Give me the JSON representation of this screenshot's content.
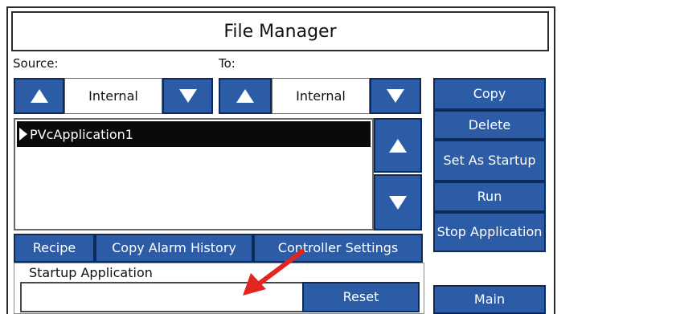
{
  "window": {
    "title": "File Manager"
  },
  "source": {
    "label": "Source:",
    "drive": "Internal"
  },
  "destination": {
    "label": "To:",
    "drive": "Internal"
  },
  "file_list": {
    "items": [
      "PVcApplication1"
    ]
  },
  "side_buttons": {
    "copy": "Copy",
    "delete": "Delete",
    "set_as_startup": "Set As Startup",
    "run": "Run",
    "stop_application": "Stop Application",
    "main": "Main"
  },
  "bottom_buttons": {
    "recipe": "Recipe",
    "copy_alarm_history": "Copy Alarm History",
    "controller_settings": "Controller Settings"
  },
  "startup": {
    "label": "Startup Application",
    "value": "",
    "reset": "Reset"
  },
  "colors": {
    "button_blue": "#2c5ca6",
    "button_border": "#0d2a5c",
    "annotation_arrow": "#e0261f",
    "selection": "#0a0a0a"
  },
  "icons": [
    "arrow-up-icon",
    "arrow-down-icon",
    "selection-pointer-icon",
    "annotation-arrow"
  ]
}
